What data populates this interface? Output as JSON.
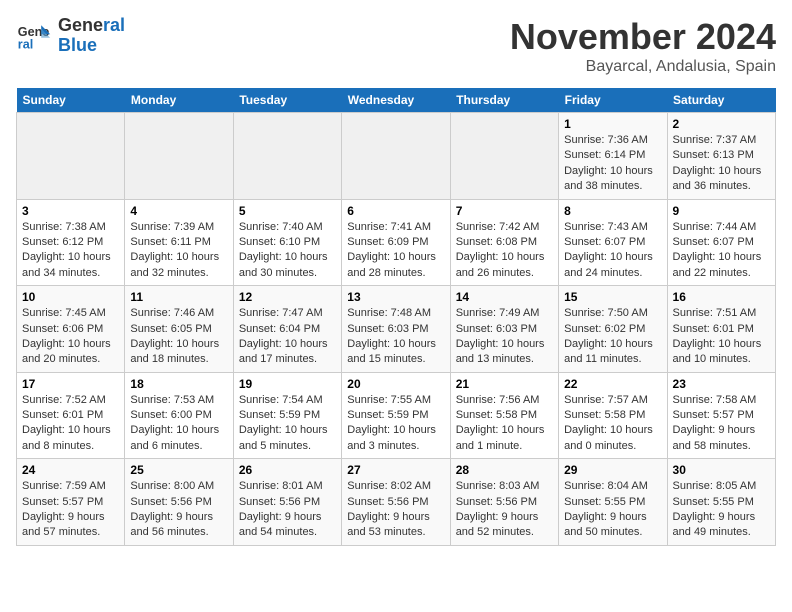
{
  "header": {
    "logo_line1": "General",
    "logo_line2": "Blue",
    "month_title": "November 2024",
    "location": "Bayarcal, Andalusia, Spain"
  },
  "weekdays": [
    "Sunday",
    "Monday",
    "Tuesday",
    "Wednesday",
    "Thursday",
    "Friday",
    "Saturday"
  ],
  "weeks": [
    [
      {
        "day": "",
        "info": ""
      },
      {
        "day": "",
        "info": ""
      },
      {
        "day": "",
        "info": ""
      },
      {
        "day": "",
        "info": ""
      },
      {
        "day": "",
        "info": ""
      },
      {
        "day": "1",
        "info": "Sunrise: 7:36 AM\nSunset: 6:14 PM\nDaylight: 10 hours and 38 minutes."
      },
      {
        "day": "2",
        "info": "Sunrise: 7:37 AM\nSunset: 6:13 PM\nDaylight: 10 hours and 36 minutes."
      }
    ],
    [
      {
        "day": "3",
        "info": "Sunrise: 7:38 AM\nSunset: 6:12 PM\nDaylight: 10 hours and 34 minutes."
      },
      {
        "day": "4",
        "info": "Sunrise: 7:39 AM\nSunset: 6:11 PM\nDaylight: 10 hours and 32 minutes."
      },
      {
        "day": "5",
        "info": "Sunrise: 7:40 AM\nSunset: 6:10 PM\nDaylight: 10 hours and 30 minutes."
      },
      {
        "day": "6",
        "info": "Sunrise: 7:41 AM\nSunset: 6:09 PM\nDaylight: 10 hours and 28 minutes."
      },
      {
        "day": "7",
        "info": "Sunrise: 7:42 AM\nSunset: 6:08 PM\nDaylight: 10 hours and 26 minutes."
      },
      {
        "day": "8",
        "info": "Sunrise: 7:43 AM\nSunset: 6:07 PM\nDaylight: 10 hours and 24 minutes."
      },
      {
        "day": "9",
        "info": "Sunrise: 7:44 AM\nSunset: 6:07 PM\nDaylight: 10 hours and 22 minutes."
      }
    ],
    [
      {
        "day": "10",
        "info": "Sunrise: 7:45 AM\nSunset: 6:06 PM\nDaylight: 10 hours and 20 minutes."
      },
      {
        "day": "11",
        "info": "Sunrise: 7:46 AM\nSunset: 6:05 PM\nDaylight: 10 hours and 18 minutes."
      },
      {
        "day": "12",
        "info": "Sunrise: 7:47 AM\nSunset: 6:04 PM\nDaylight: 10 hours and 17 minutes."
      },
      {
        "day": "13",
        "info": "Sunrise: 7:48 AM\nSunset: 6:03 PM\nDaylight: 10 hours and 15 minutes."
      },
      {
        "day": "14",
        "info": "Sunrise: 7:49 AM\nSunset: 6:03 PM\nDaylight: 10 hours and 13 minutes."
      },
      {
        "day": "15",
        "info": "Sunrise: 7:50 AM\nSunset: 6:02 PM\nDaylight: 10 hours and 11 minutes."
      },
      {
        "day": "16",
        "info": "Sunrise: 7:51 AM\nSunset: 6:01 PM\nDaylight: 10 hours and 10 minutes."
      }
    ],
    [
      {
        "day": "17",
        "info": "Sunrise: 7:52 AM\nSunset: 6:01 PM\nDaylight: 10 hours and 8 minutes."
      },
      {
        "day": "18",
        "info": "Sunrise: 7:53 AM\nSunset: 6:00 PM\nDaylight: 10 hours and 6 minutes."
      },
      {
        "day": "19",
        "info": "Sunrise: 7:54 AM\nSunset: 5:59 PM\nDaylight: 10 hours and 5 minutes."
      },
      {
        "day": "20",
        "info": "Sunrise: 7:55 AM\nSunset: 5:59 PM\nDaylight: 10 hours and 3 minutes."
      },
      {
        "day": "21",
        "info": "Sunrise: 7:56 AM\nSunset: 5:58 PM\nDaylight: 10 hours and 1 minute."
      },
      {
        "day": "22",
        "info": "Sunrise: 7:57 AM\nSunset: 5:58 PM\nDaylight: 10 hours and 0 minutes."
      },
      {
        "day": "23",
        "info": "Sunrise: 7:58 AM\nSunset: 5:57 PM\nDaylight: 9 hours and 58 minutes."
      }
    ],
    [
      {
        "day": "24",
        "info": "Sunrise: 7:59 AM\nSunset: 5:57 PM\nDaylight: 9 hours and 57 minutes."
      },
      {
        "day": "25",
        "info": "Sunrise: 8:00 AM\nSunset: 5:56 PM\nDaylight: 9 hours and 56 minutes."
      },
      {
        "day": "26",
        "info": "Sunrise: 8:01 AM\nSunset: 5:56 PM\nDaylight: 9 hours and 54 minutes."
      },
      {
        "day": "27",
        "info": "Sunrise: 8:02 AM\nSunset: 5:56 PM\nDaylight: 9 hours and 53 minutes."
      },
      {
        "day": "28",
        "info": "Sunrise: 8:03 AM\nSunset: 5:56 PM\nDaylight: 9 hours and 52 minutes."
      },
      {
        "day": "29",
        "info": "Sunrise: 8:04 AM\nSunset: 5:55 PM\nDaylight: 9 hours and 50 minutes."
      },
      {
        "day": "30",
        "info": "Sunrise: 8:05 AM\nSunset: 5:55 PM\nDaylight: 9 hours and 49 minutes."
      }
    ]
  ]
}
